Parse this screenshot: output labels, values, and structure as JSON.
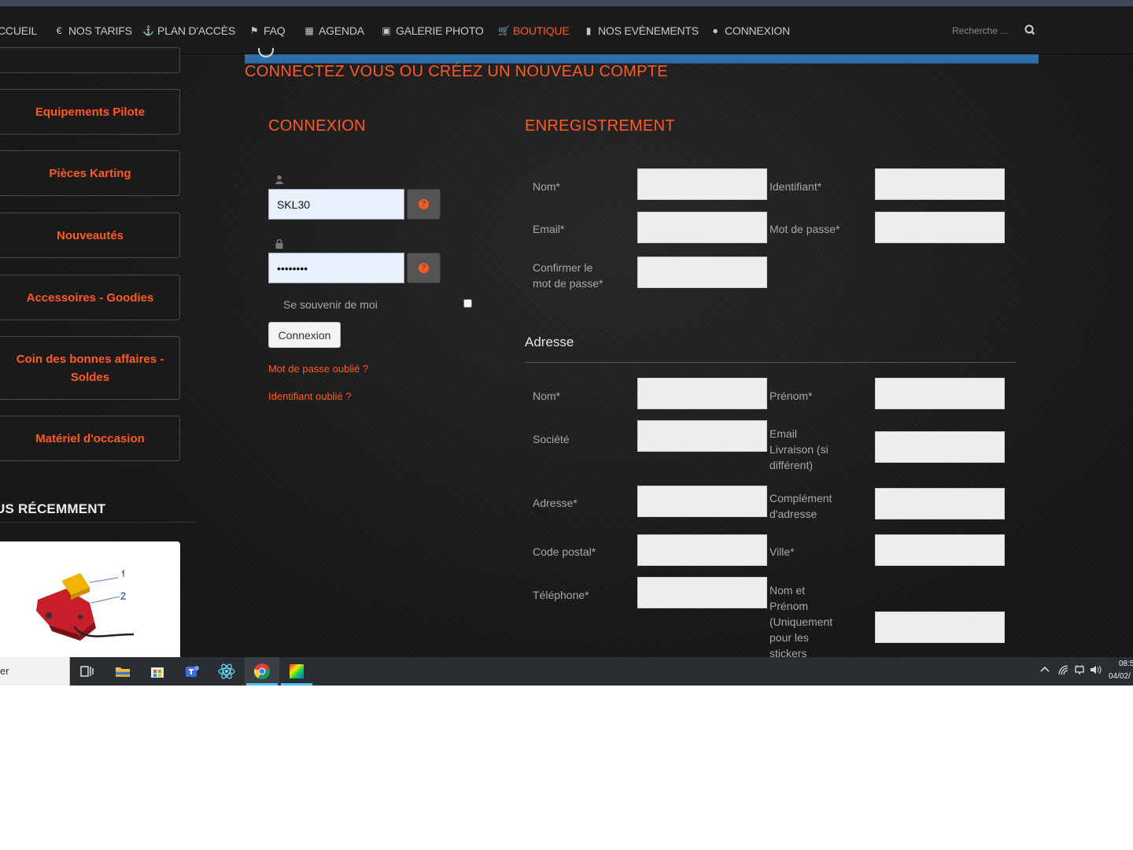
{
  "nav": {
    "items": [
      {
        "label": "CCUEIL",
        "icon": ""
      },
      {
        "label": "NOS TARIFS",
        "icon": "euro-icon"
      },
      {
        "label": "PLAN D'ACCÈS",
        "icon": "anchor-icon"
      },
      {
        "label": "FAQ",
        "icon": "flag-icon"
      },
      {
        "label": "AGENDA",
        "icon": "calendar-icon"
      },
      {
        "label": "GALERIE PHOTO",
        "icon": "image-icon"
      },
      {
        "label": "BOUTIQUE",
        "icon": "cart-icon"
      },
      {
        "label": "NOS EVÈNEMENTS",
        "icon": "bookmark-icon"
      },
      {
        "label": "CONNEXION",
        "icon": "user-icon"
      }
    ],
    "search_placeholder": "Recherche ..."
  },
  "sidebar": {
    "categories": [
      {
        "label": "Equipements Pilote"
      },
      {
        "label": "Pièces Karting"
      },
      {
        "label": "Nouveautés"
      },
      {
        "label": "Accessoires - Goodies"
      },
      {
        "label": "Coin des bonnes affaires - Soldes"
      },
      {
        "label": "Matériel d'occasion"
      }
    ],
    "recent_title": "US RÉCEMMENT"
  },
  "main": {
    "heading": "CONNECTEZ VOUS OU CRÉEZ UN NOUVEAU COMPTE",
    "login": {
      "title": "CONNEXION",
      "username_value": "SKL30",
      "password_value": "••••••••",
      "remember_label": "Se souvenir de moi",
      "submit_label": "Connexion",
      "forgot_password": "Mot de passe oublié ?",
      "forgot_username": "Identifiant oublié ?"
    },
    "register": {
      "title": "ENREGISTREMENT",
      "nom": "Nom*",
      "identifiant": "Identifiant*",
      "email": "Email*",
      "mot_de_passe": "Mot de passe*",
      "confirm_line1": "Confirmer le",
      "confirm_line2": "mot de passe*"
    },
    "address": {
      "title": "Adresse",
      "nom": "Nom*",
      "prenom": "Prénom*",
      "societe": "Société",
      "email_livraison": [
        "Email",
        "Livraison (si",
        "différent)"
      ],
      "adresse": "Adresse*",
      "complement": [
        "Complément",
        "d'adresse"
      ],
      "code_postal": "Code postal*",
      "ville": "Ville*",
      "telephone": "Téléphone*",
      "nom_prenom_stickers": [
        "Nom et",
        "Prénom",
        "(Uniquement",
        "pour les",
        "stickers"
      ]
    }
  },
  "taskbar": {
    "search_text": "er",
    "clock_time": "08:5",
    "clock_date": "04/02/"
  },
  "colors": {
    "accent": "#ff5a1f",
    "bluebar": "#2f6fa8",
    "background": "#151515"
  }
}
